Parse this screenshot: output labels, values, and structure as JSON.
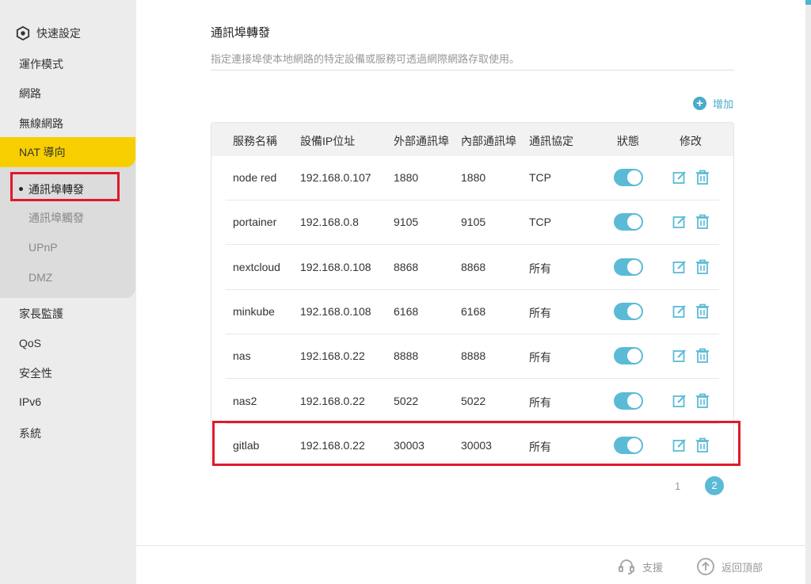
{
  "sidebar": {
    "quick_setup": "快速設定",
    "operation_mode": "運作模式",
    "network": "網路",
    "wireless": "無線網路",
    "nat": "NAT 導向",
    "nat_items": [
      "通訊埠轉發",
      "通訊埠觸發",
      "UPnP",
      "DMZ"
    ],
    "parental": "家長監護",
    "qos": "QoS",
    "security": "安全性",
    "ipv6": "IPv6",
    "system": "系統"
  },
  "main": {
    "title": "通訊埠轉發",
    "description": "指定連接埠使本地網路的特定設備或服務可透過網際網路存取使用。",
    "add_label": "增加"
  },
  "table": {
    "headers": [
      "服務名稱",
      "設備IP位址",
      "外部通訊埠",
      "內部通訊埠",
      "通訊協定",
      "狀態",
      "修改"
    ],
    "rows": [
      {
        "name": "node red",
        "ip": "192.168.0.107",
        "ext": "1880",
        "int": "1880",
        "proto": "TCP",
        "enabled": true
      },
      {
        "name": "portainer",
        "ip": "192.168.0.8",
        "ext": "9105",
        "int": "9105",
        "proto": "TCP",
        "enabled": true
      },
      {
        "name": "nextcloud",
        "ip": "192.168.0.108",
        "ext": "8868",
        "int": "8868",
        "proto": "所有",
        "enabled": true
      },
      {
        "name": "minkube",
        "ip": "192.168.0.108",
        "ext": "6168",
        "int": "6168",
        "proto": "所有",
        "enabled": true
      },
      {
        "name": "nas",
        "ip": "192.168.0.22",
        "ext": "8888",
        "int": "8888",
        "proto": "所有",
        "enabled": true
      },
      {
        "name": "nas2",
        "ip": "192.168.0.22",
        "ext": "5022",
        "int": "5022",
        "proto": "所有",
        "enabled": true
      },
      {
        "name": "gitlab",
        "ip": "192.168.0.22",
        "ext": "30003",
        "int": "30003",
        "proto": "所有",
        "enabled": true
      }
    ]
  },
  "pagination": {
    "pages": [
      "1",
      "2"
    ],
    "current": "2"
  },
  "footer": {
    "support": "支援",
    "back_to_top": "返回頂部"
  },
  "colors": {
    "accent": "#5bbbd6",
    "nat_highlight": "#f7cf00",
    "annotation": "#e0192b"
  }
}
